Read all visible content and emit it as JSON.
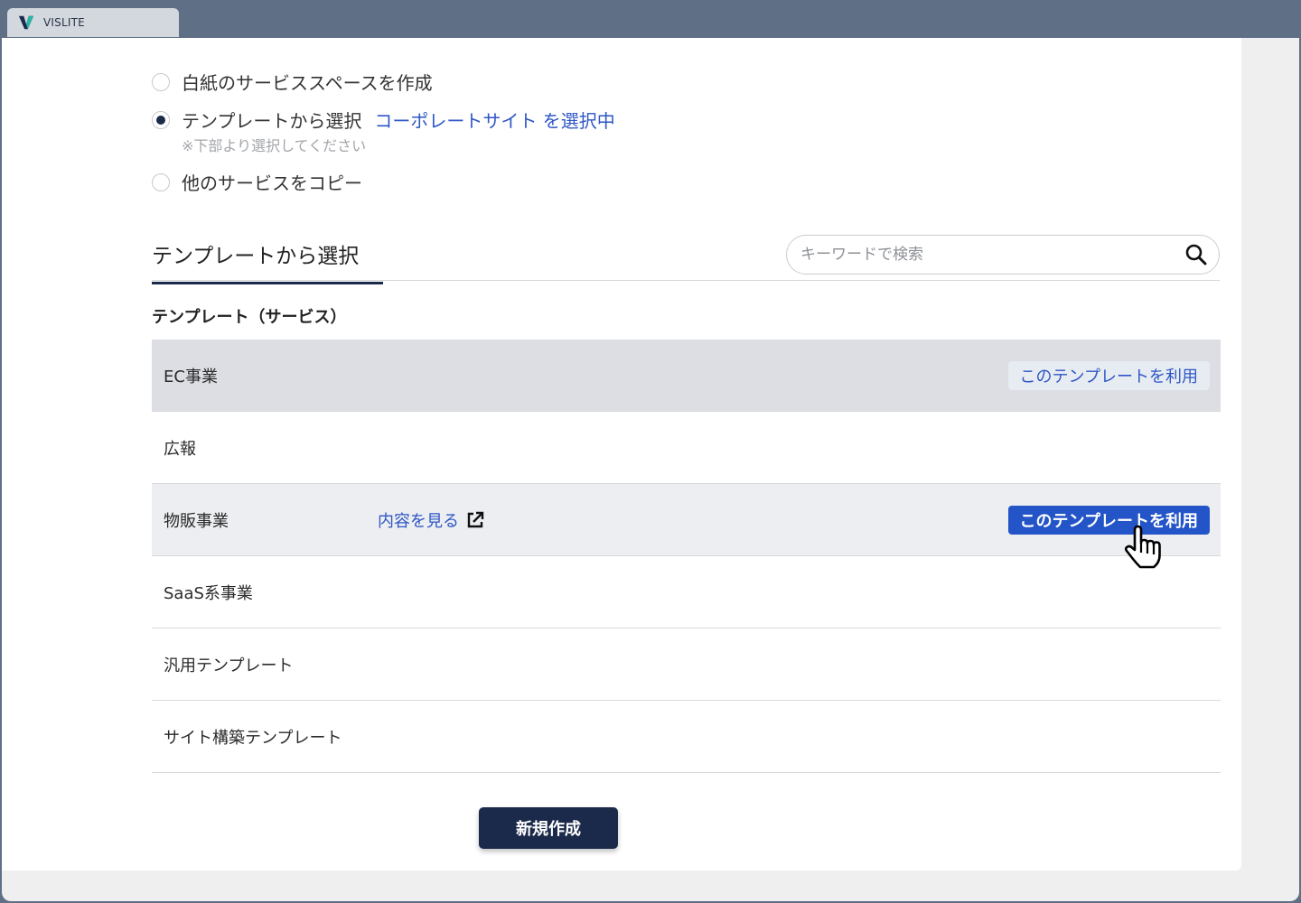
{
  "app": {
    "title": "VISLITE"
  },
  "options": {
    "blank": "白紙のサービススペースを作成",
    "template": "テンプレートから選択",
    "template_selected": "コーポレートサイト を選択中",
    "template_hint": "※下部より選択してください",
    "copy": "他のサービスをコピー",
    "selected_option": "template"
  },
  "section": {
    "title": "テンプレートから選択",
    "search_placeholder": "キーワードで検索",
    "subtitle": "テンプレート（サービス）"
  },
  "templates": [
    {
      "name": "EC事業",
      "button": "このテンプレートを利用",
      "state": "hover"
    },
    {
      "name": "広報"
    },
    {
      "name": "物販事業",
      "link": "内容を見る",
      "button": "このテンプレートを利用",
      "state": "active"
    },
    {
      "name": "SaaS系事業"
    },
    {
      "name": "汎用テンプレート"
    },
    {
      "name": "サイト構築テンプレート"
    }
  ],
  "footer": {
    "create_label": "新規作成"
  },
  "colors": {
    "navy": "#1b2a4a",
    "accent": "#2354c8",
    "link": "#2e57c6"
  },
  "icons": [
    "vislite-logo-icon",
    "search-icon",
    "external-link-icon",
    "hand-pointer-icon"
  ]
}
